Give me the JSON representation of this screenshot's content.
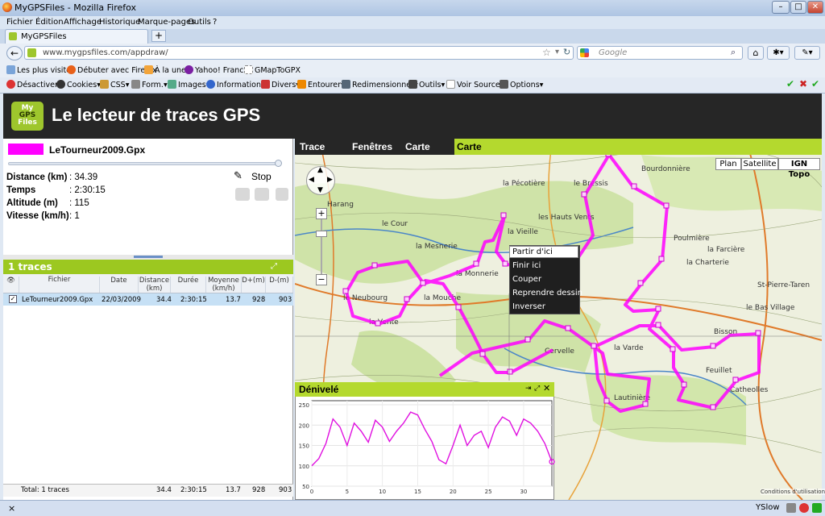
{
  "window": {
    "title": "MyGPSFiles - Mozilla Firefox"
  },
  "menu": [
    "Fichier",
    "Édition",
    "Affichage",
    "Historique",
    "Marque-pages",
    "Outils",
    "?"
  ],
  "tab": {
    "label": "MyGPSFiles",
    "new_tab": "+"
  },
  "nav": {
    "url": "www.mygpsfiles.com/appdraw/",
    "search_placeholder": "Google"
  },
  "bookmarks": [
    "Les plus visités",
    "Débuter avec Firefox",
    "À la une",
    "Yahoo! France",
    "GMapToGPX"
  ],
  "devtools": [
    "Désactiver",
    "Cookies",
    "CSS",
    "Form.",
    "Images",
    "Information",
    "Divers",
    "Entourer",
    "Redimensionner",
    "Outils",
    "Voir Source",
    "Options"
  ],
  "app": {
    "logo_line1": "My",
    "logo_line2": "GPS",
    "logo_line3": "Files",
    "title": "Le lecteur de traces GPS"
  },
  "track": {
    "name": "LeTourneur2009.Gpx",
    "color": "#ff00ff",
    "stats": [
      {
        "label": "Distance (km)",
        "value": ": 34.39"
      },
      {
        "label": "Temps",
        "value": ": 2:30:15"
      },
      {
        "label": "Altitude (m)",
        "value": ": 115"
      },
      {
        "label": "Vitesse (km/h)",
        "value": ": 1"
      }
    ],
    "stop_label": "Stop",
    "progress": 0.99
  },
  "traces": {
    "header": "1 traces",
    "columns": [
      "Fichier",
      "Date",
      "Distance (km)",
      "Durée",
      "Moyenne (km/h)",
      "D+(m)",
      "D-(m)"
    ],
    "rows": [
      {
        "file": "LeTourneur2009.Gpx",
        "date": "22/03/2009",
        "distance": "34.4",
        "duration": "2:30:15",
        "avg": "13.7",
        "dplus": "928",
        "dminus": "903"
      }
    ],
    "footer": {
      "label": "Total: 1 traces",
      "distance": "34.4",
      "duration": "2:30:15",
      "avg": "13.7",
      "dplus": "928",
      "dminus": "903"
    }
  },
  "map": {
    "nav": [
      "Trace",
      "Fenêtres",
      "Carte"
    ],
    "active_tab": "Carte",
    "types": [
      "Plan",
      "Satellite",
      "IGN Topo"
    ],
    "selected_type": "IGN Topo",
    "place_labels": [
      "le Bressis",
      "la Pécotière",
      "Harang",
      "les Hauts Vents",
      "la Vieille",
      "la Mesnerie",
      "la Monnerie",
      "le Neubourg",
      "la Mouche",
      "la Vente",
      "Cervelle",
      "Lautinière",
      "Catheolles",
      "St-Pierre-Taren",
      "Feuillet",
      "la Varde",
      "Bisson",
      "le Bas Village",
      "la Charterie",
      "Poulmière",
      "la Farcière",
      "le Cour",
      "Bourdonnière"
    ],
    "context_menu": [
      "Partir d'ici",
      "Finir ici",
      "Couper",
      "Reprendre dessin",
      "Inverser"
    ],
    "copyright": "Conditions d'utilisation"
  },
  "elevation": {
    "title": "Dénivelé",
    "chart_data": {
      "type": "line",
      "x": [
        0,
        1,
        2,
        3,
        4,
        5,
        6,
        7,
        8,
        9,
        10,
        11,
        12,
        13,
        14,
        15,
        16,
        17,
        18,
        19,
        20,
        21,
        22,
        23,
        24,
        25,
        26,
        27,
        28,
        29,
        30,
        31,
        32,
        33,
        34
      ],
      "y": [
        100,
        118,
        155,
        215,
        195,
        150,
        205,
        185,
        158,
        212,
        195,
        160,
        185,
        205,
        232,
        225,
        190,
        160,
        115,
        105,
        150,
        200,
        150,
        175,
        185,
        145,
        195,
        220,
        210,
        175,
        215,
        205,
        185,
        155,
        110
      ],
      "xticks": [
        0,
        5,
        10,
        15,
        20,
        25,
        30
      ],
      "yticks": [
        50,
        100,
        150,
        200,
        250
      ],
      "xlim": [
        0,
        34
      ],
      "ylim": [
        50,
        260
      ],
      "color": "#e010e0"
    }
  },
  "status": {
    "close": "×",
    "yslow": "YSlow"
  }
}
